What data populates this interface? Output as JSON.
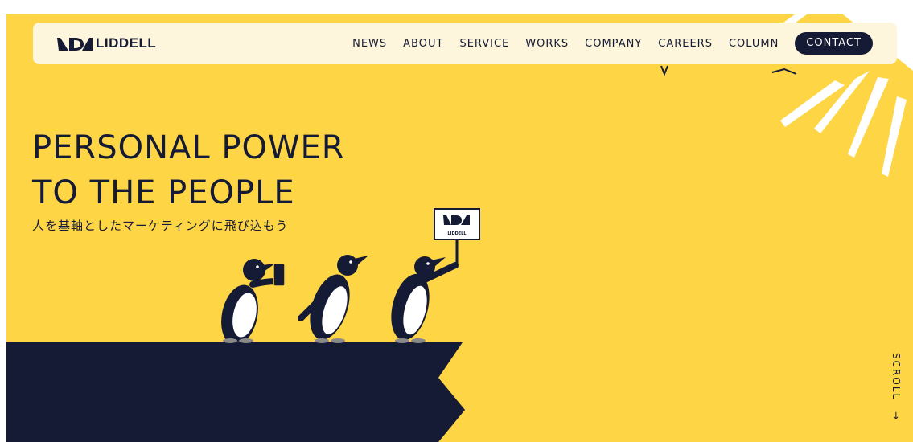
{
  "header": {
    "logo_text": "LIDDELL",
    "nav": [
      "NEWS",
      "ABOUT",
      "SERVICE",
      "WORKS",
      "COMPANY",
      "CAREERS",
      "COLUMN"
    ],
    "contact_label": "CONTACT"
  },
  "hero": {
    "headline_line1": "PERSONAL POWER",
    "headline_line2": "TO THE PEOPLE",
    "subline": "人を基軸としたマーケティングに飛び込もう",
    "sign_text": "LIDDELL",
    "scroll_label": "SCROLL",
    "scroll_arrow": "→"
  },
  "colors": {
    "background": "#fdd545",
    "navy": "#151a35",
    "header_bg": "#fdf6dc"
  }
}
